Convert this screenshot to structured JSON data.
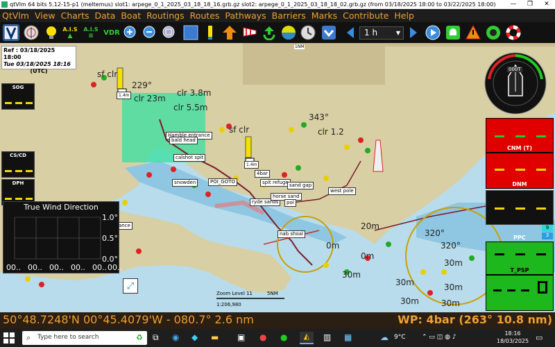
{
  "titlebar": {
    "text": "qtVlm 64 bits 5.12-15-p1 (meltemus) slot1: arpege_0_1_2025_03_18_18_16.grb.gz slot2: arpege_0_1_2025_03_18_18_02.grb.gz (from 03/18/2025 18:00 to 03/22/2025 18:00)",
    "minimize": "—",
    "maximize": "❐",
    "close": "✕"
  },
  "menu": [
    "QtVlm",
    "View",
    "Charts",
    "Data",
    "Boat",
    "Routings",
    "Routes",
    "Pathways",
    "Barriers",
    "Marks",
    "Contribute",
    "Help"
  ],
  "toolbar": {
    "ais_label_1": "A.I.S",
    "ais_label_2": "A.I.S",
    "vdr_label": "VDR",
    "time_step": "1 h",
    "time_step_options": [
      "1 h"
    ]
  },
  "reference": {
    "line1": "Ref : 03/18/2025 18:00",
    "line2": "Tue 03/18/2025 18:16",
    "line3": "(UTC)"
  },
  "left_gauges": [
    {
      "label": "SOG"
    },
    {
      "label": "CS/CD"
    },
    {
      "label": "DPH"
    }
  ],
  "wind_chart": {
    "title": "True Wind Direction",
    "y_ticks": [
      "1.0°",
      "0.5°",
      "0.0°"
    ],
    "x_ticks": [
      "00..",
      "00..",
      "00..",
      "00..",
      "00..",
      "00.."
    ]
  },
  "right_panel": {
    "compass_text": "000T",
    "cnm_label": "CNM (T)",
    "dnm_label": "DNM",
    "ppc_label": "PPC",
    "ppc_badge1": "9",
    "ppc_badge2": "3",
    "tpsp_label": "T_PSP"
  },
  "map": {
    "labels": [
      {
        "text": "sf clr"
      },
      {
        "text": "229°"
      },
      {
        "text": "clr 3.8m"
      },
      {
        "text": "clr 23m"
      },
      {
        "text": "clr 5.5m"
      },
      {
        "text": "sf clr"
      },
      {
        "text": "343°"
      },
      {
        "text": "clr 1.2"
      },
      {
        "text": "320°"
      },
      {
        "text": "320°"
      },
      {
        "text": "30m"
      },
      {
        "text": "30m"
      },
      {
        "text": "30m"
      },
      {
        "text": "30m"
      },
      {
        "text": "30m"
      },
      {
        "text": "30m"
      },
      {
        "text": "20m"
      },
      {
        "text": "0m"
      },
      {
        "text": "0m"
      }
    ],
    "pois": [
      "Hamble entrance",
      "bald head",
      "calshot spit",
      "snowden",
      "POI_GOTO",
      "4bar",
      "spit refuge",
      "sand gap",
      "west pole",
      "ryde sands",
      "horse sand",
      "pol",
      "nab shoal",
      "ance"
    ],
    "zoom_label": "Zoom Level 11",
    "scale_label": "5NM",
    "scale_ratio": "1:206,980",
    "top_scale": "1NM",
    "small_marks": [
      "1.4m",
      "1.4m"
    ]
  },
  "status": {
    "position": "50°48.7248'N 00°45.4079'W - 080.7° 2.6 nm",
    "waypoint": "WP: 4bar (263° 10.8 nm)"
  },
  "taskbar": {
    "search_placeholder": "Type here to search",
    "weather": "9°C",
    "time": "18:16",
    "date": "18/03/2025"
  }
}
